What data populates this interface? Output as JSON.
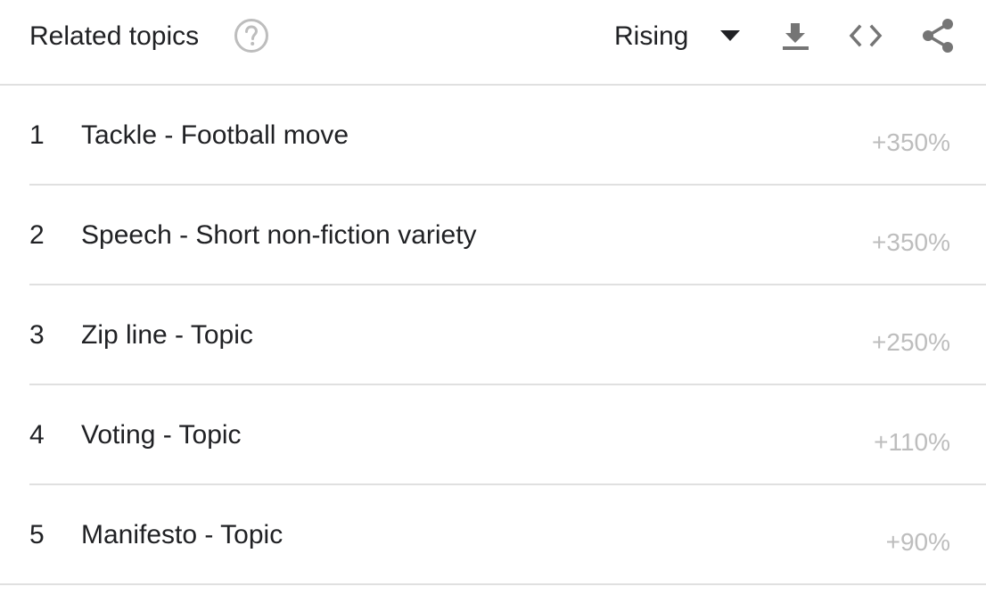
{
  "header": {
    "title": "Related topics",
    "help_icon": "help-circle-icon",
    "metric_selector": {
      "selected": "Rising"
    },
    "tools": [
      {
        "name": "download-icon"
      },
      {
        "name": "embed-code-icon"
      },
      {
        "name": "share-icon"
      }
    ]
  },
  "colors": {
    "text": "#202124",
    "value_text": "#bdbdbd",
    "icon": "#757575",
    "divider": "#e0e0e0"
  },
  "rows": [
    {
      "rank": "1",
      "topic": "Tackle - Football move",
      "value": "+350%"
    },
    {
      "rank": "2",
      "topic": "Speech - Short non-fiction variety",
      "value": "+350%"
    },
    {
      "rank": "3",
      "topic": "Zip line - Topic",
      "value": "+250%"
    },
    {
      "rank": "4",
      "topic": "Voting - Topic",
      "value": "+110%"
    },
    {
      "rank": "5",
      "topic": "Manifesto - Topic",
      "value": "+90%"
    }
  ]
}
